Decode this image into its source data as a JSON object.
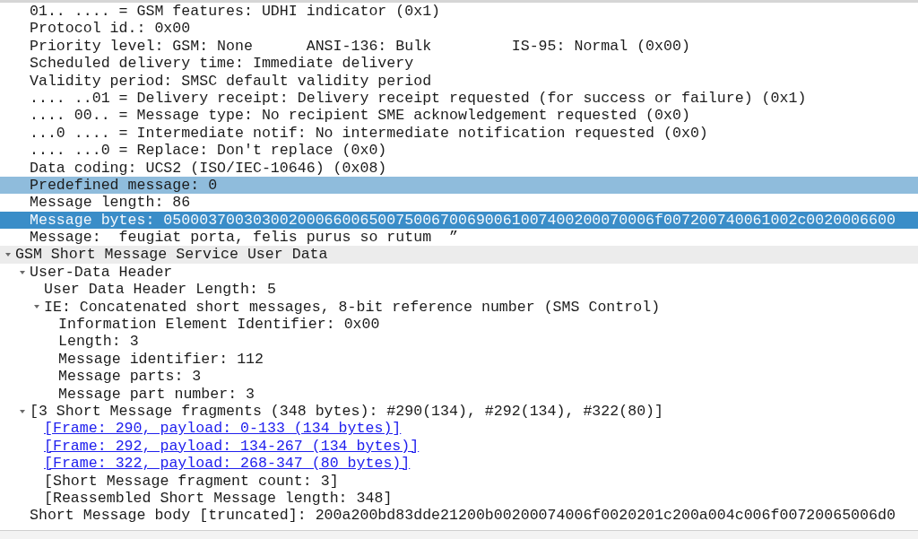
{
  "tree": [
    {
      "children": [
        {
          "label": "01.. .... = GSM features: UDHI indicator (0x1)",
          "kind": "field",
          "selected": false,
          "related": false
        },
        {
          "label": "Protocol id.: 0x00",
          "kind": "field",
          "selected": false,
          "related": false
        },
        {
          "label": "Priority level: GSM: None      ANSI-136: Bulk         IS-95: Normal (0x00)",
          "kind": "field",
          "selected": false,
          "related": false
        },
        {
          "label": "Scheduled delivery time: Immediate delivery",
          "kind": "field",
          "selected": false,
          "related": false
        },
        {
          "label": "Validity period: SMSC default validity period",
          "kind": "field",
          "selected": false,
          "related": false
        },
        {
          "label": ".... ..01 = Delivery receipt: Delivery receipt requested (for success or failure) (0x1)",
          "kind": "field",
          "selected": false,
          "related": false
        },
        {
          "label": ".... 00.. = Message type: No recipient SME acknowledgement requested (0x0)",
          "kind": "field",
          "selected": false,
          "related": false
        },
        {
          "label": "...0 .... = Intermediate notif: No intermediate notification requested (0x0)",
          "kind": "field",
          "selected": false,
          "related": false
        },
        {
          "label": ".... ...0 = Replace: Don't replace (0x0)",
          "kind": "field",
          "selected": false,
          "related": false
        },
        {
          "label": "Data coding: UCS2 (ISO/IEC-10646) (0x08)",
          "kind": "field",
          "selected": false,
          "related": false
        },
        {
          "label": "Predefined message: 0",
          "kind": "field",
          "selected": false,
          "related": true
        },
        {
          "label": "Message length: 86",
          "kind": "field",
          "selected": false,
          "related": false
        },
        {
          "label": "Message bytes: 0500037003030020006600650075006700690061007400200070006f007200740061002c0020006600",
          "kind": "field",
          "selected": true,
          "related": false
        },
        {
          "label": "Message:  feugiat porta, felis purus so rutum  ”",
          "kind": "field",
          "selected": false,
          "related": false
        }
      ]
    },
    {
      "label": "GSM Short Message Service User Data",
      "kind": "field",
      "selected": false,
      "related": false,
      "expanded": true,
      "children": [
        {
          "label": "User-Data Header",
          "kind": "field",
          "selected": false,
          "related": false,
          "expanded": true,
          "children": [
            {
              "label": "User Data Header Length: 5",
              "kind": "field",
              "selected": false,
              "related": false
            },
            {
              "label": "IE: Concatenated short messages, 8-bit reference number (SMS Control)",
              "kind": "field",
              "selected": false,
              "related": false,
              "expanded": true,
              "children": [
                {
                  "label": "Information Element Identifier: 0x00",
                  "kind": "field",
                  "selected": false,
                  "related": false
                },
                {
                  "label": "Length: 3",
                  "kind": "field",
                  "selected": false,
                  "related": false
                },
                {
                  "label": "Message identifier: 112",
                  "kind": "field",
                  "selected": false,
                  "related": false
                },
                {
                  "label": "Message parts: 3",
                  "kind": "field",
                  "selected": false,
                  "related": false
                },
                {
                  "label": "Message part number: 3",
                  "kind": "field",
                  "selected": false,
                  "related": false
                }
              ]
            }
          ]
        },
        {
          "label": "[3 Short Message fragments (348 bytes): #290(134), #292(134), #322(80)]",
          "kind": "field",
          "selected": false,
          "related": false,
          "expanded": true,
          "children": [
            {
              "label": "[Frame: 290, payload: 0-133 (134 bytes)]",
              "kind": "link",
              "selected": false,
              "related": false
            },
            {
              "label": "[Frame: 292, payload: 134-267 (134 bytes)]",
              "kind": "link",
              "selected": false,
              "related": false
            },
            {
              "label": "[Frame: 322, payload: 268-347 (80 bytes)]",
              "kind": "link",
              "selected": false,
              "related": false
            },
            {
              "label": "[Short Message fragment count: 3]",
              "kind": "field",
              "selected": false,
              "related": false
            },
            {
              "label": "[Reassembled Short Message length: 348]",
              "kind": "field",
              "selected": false,
              "related": false
            }
          ]
        },
        {
          "label": "Short Message body [truncated]: 200a200bd83dde21200b00200074006f0020201c200a004c006f00720065006d0",
          "kind": "field",
          "selected": false,
          "related": false
        }
      ]
    }
  ]
}
